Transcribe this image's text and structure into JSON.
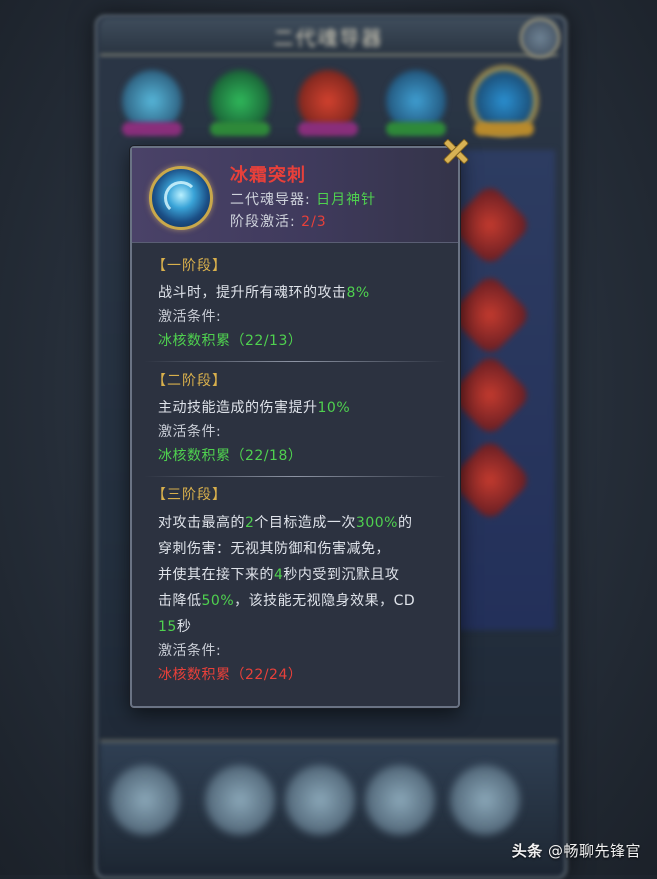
{
  "background": {
    "title": "二代魂导器"
  },
  "popup": {
    "skill_name": "冰霜突刺",
    "device_label": "二代魂导器:",
    "device_name": "日月神针",
    "stage_label": "阶段激活:",
    "stage_value": "2/3",
    "stages": [
      {
        "title": "【一阶段】",
        "desc_pre": "战斗时，提升所有魂环的攻击",
        "desc_num": "8%",
        "cond_label": "激活条件:",
        "cond_value": "冰核数积累（22/13）",
        "cond_met": true
      },
      {
        "title": "【二阶段】",
        "desc_pre": "主动技能造成的伤害提升",
        "desc_num": "10%",
        "cond_label": "激活条件:",
        "cond_value": "冰核数积累（22/18）",
        "cond_met": true
      },
      {
        "title": "【三阶段】",
        "desc_lines": [
          [
            "对攻击最高的",
            "2",
            "个目标造成一次",
            "300%",
            "的"
          ],
          [
            "穿刺伤害：无视其防御和伤害减免，"
          ],
          [
            "并使其在接下来的",
            "4",
            "秒内受到沉默且攻"
          ],
          [
            "击降低",
            "50%",
            "，该技能无视隐身效果，CD"
          ],
          [
            "",
            "15",
            "秒"
          ]
        ],
        "cond_label": "激活条件:",
        "cond_value": "冰核数积累（22/24）",
        "cond_met": false
      }
    ]
  },
  "colors": {
    "accent_gold": "#d9b04c",
    "skill_red": "#e8403a",
    "value_green": "#4fd14f"
  },
  "icons": {
    "skill": "frost-orb-icon",
    "close": "close-x-icon"
  },
  "watermark": {
    "brand": "头条",
    "author": "@畅聊先锋官"
  }
}
